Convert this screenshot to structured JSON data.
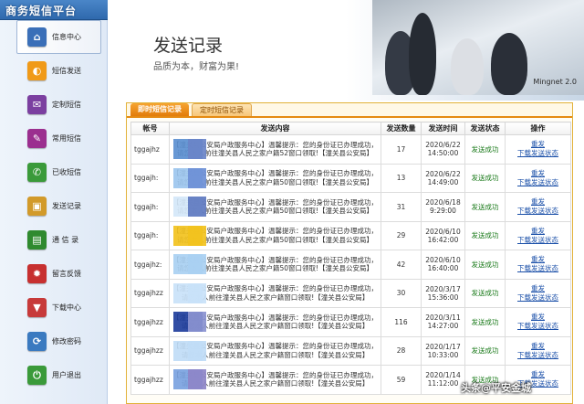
{
  "app": {
    "title": "商务短信平台"
  },
  "sidebar": {
    "items": [
      {
        "label": "信息中心",
        "icon": "home-icon",
        "color": "#3a6fb8",
        "glyph": "⌂"
      },
      {
        "label": "短信发送",
        "icon": "send-icon",
        "color": "#f09a18",
        "glyph": "◐"
      },
      {
        "label": "定制短信",
        "icon": "envelope-icon",
        "color": "#7b3fa0",
        "glyph": "✉"
      },
      {
        "label": "常用短信",
        "icon": "note-icon",
        "color": "#9b2f8f",
        "glyph": "✎"
      },
      {
        "label": "已收短信",
        "icon": "phone-icon",
        "color": "#3a9a3a",
        "glyph": "✆"
      },
      {
        "label": "发送记录",
        "icon": "record-icon",
        "color": "#d29a2a",
        "glyph": "▣"
      },
      {
        "label": "通 信 录",
        "icon": "save-icon",
        "color": "#2f8a2f",
        "glyph": "▤"
      },
      {
        "label": "留言反馈",
        "icon": "feedback-icon",
        "color": "#c73030",
        "glyph": "✹"
      },
      {
        "label": "下载中心",
        "icon": "download-icon",
        "color": "#c73a3a",
        "glyph": "▼"
      },
      {
        "label": "修改密码",
        "icon": "password-icon",
        "color": "#3a7ac0",
        "glyph": "⟳"
      },
      {
        "label": "用户退出",
        "icon": "logout-icon",
        "color": "#3a9a3a",
        "glyph": "⏻"
      }
    ]
  },
  "header": {
    "title": "发送记录",
    "subtitle": "品质为本，财富为果!",
    "version": "Mingnet 2.0"
  },
  "tabs": [
    {
      "label": "即时短信记录",
      "active": true
    },
    {
      "label": "定时短信记录",
      "active": false
    }
  ],
  "table": {
    "columns": [
      "帐号",
      "发送内容",
      "发送数量",
      "发送时间",
      "发送状态",
      "操作"
    ],
    "rows": [
      {
        "account": "tggajhz",
        "content": "【潼关县公安局户政服务中心】温馨提示：您的身份证已办理成功，请您本人前往潼关县人民之家户籍52窗口领取!【潼关县公安局】",
        "count": "17",
        "date": "2020/6/22",
        "time": "14:50:00",
        "status": "发送成功",
        "op1": "重发",
        "op2": "下载发送状态",
        "c1": "#5b8fd0",
        "c2": "#6a84c8"
      },
      {
        "account": "tggajh:",
        "content": "【潼关县公安局户政服务中心】温馨提示：您的身份证已办理成功，请您本人前往潼关县人民之家户籍50窗口领取!【潼关县公安局】",
        "count": "13",
        "date": "2020/6/22",
        "time": "14:49:00",
        "status": "发送成功",
        "op1": "重发",
        "op2": "下载发送状态",
        "c1": "#9cc6ee",
        "c2": "#6c8fd6"
      },
      {
        "account": "tggajh:",
        "content": "【潼关县公安局户政服务中心】温馨提示：您的身份证已办理成功，请您本人前往潼关县人民之家户籍50窗口领取!【潼关县公安局】",
        "count": "31",
        "date": "2020/6/18",
        "time": "9:29:00",
        "status": "发送成功",
        "op1": "重发",
        "op2": "下载发送状态",
        "c1": "#d4e7f8",
        "c2": "#6079c0"
      },
      {
        "account": "tggajh:",
        "content": "【潼关县公安局户政服务中心】温馨提示：您的身份证已办理成功，请您本人前往潼关县人民之家户籍50窗口领取!【潼关县公安局】",
        "count": "29",
        "date": "2020/6/10",
        "time": "16:42:00",
        "status": "发送成功",
        "op1": "重发",
        "op2": "下载发送状态",
        "c1": "#f2c21e",
        "c2": "#f2c21e"
      },
      {
        "account": "tggajhz:",
        "content": "【潼关县公安局户政服务中心】温馨提示：您的身份证已办理成功，请您本人前往潼关县人民之家户籍50窗口领取!【潼关县公安局】",
        "count": "42",
        "date": "2020/6/10",
        "time": "16:40:00",
        "status": "发送成功",
        "op1": "重发",
        "op2": "下载发送状态",
        "c1": "#a9d0f2",
        "c2": "#a9d0f2"
      },
      {
        "account": "tggajhzz",
        "content": "【潼关县公安局户政服务中心】温馨提示：您的身份证已办理成功，请您本人前往潼关县人民之家户籍窗口领取!【潼关县公安局】",
        "count": "30",
        "date": "2020/3/17",
        "time": "15:36:00",
        "status": "发送成功",
        "op1": "重发",
        "op2": "下载发送状态",
        "c1": "#c9e2f8",
        "c2": "#c9e2f8"
      },
      {
        "account": "tggajhzz",
        "content": "【潼关县公安局户政服务中心】温馨提示：您的身份证已办理成功，请您本人前往潼关县人民之家户籍窗口领取!【潼关县公安局】",
        "count": "116",
        "date": "2020/3/11",
        "time": "14:27:00",
        "status": "发送成功",
        "op1": "重发",
        "op2": "下载发送状态",
        "c1": "#1f3e9c",
        "c2": "#8a92d0"
      },
      {
        "account": "tggajhzz",
        "content": "【潼关县公安局户政服务中心】温馨提示：您的身份证已办理成功，请您本人前往潼关县人民之家户籍窗口领取!【潼关县公安局】",
        "count": "28",
        "date": "2020/1/17",
        "time": "10:33:00",
        "status": "发送成功",
        "op1": "重发",
        "op2": "下载发送状态",
        "c1": "#c0dcf6",
        "c2": "#c0dcf6"
      },
      {
        "account": "tggajhzz",
        "content": "【潼关县公安局户政服务中心】温馨提示：您的身份证已办理成功，请您本人前往潼关县人民之家户籍窗口领取!【潼关县公安局】",
        "count": "59",
        "date": "2020/1/14",
        "time": "11:12:00",
        "status": "发送成功",
        "op1": "重发",
        "op2": "下载发送状态",
        "c1": "#7aa2e0",
        "c2": "#8e86c8"
      }
    ]
  },
  "watermark": {
    "text": "头条@平安金城"
  }
}
